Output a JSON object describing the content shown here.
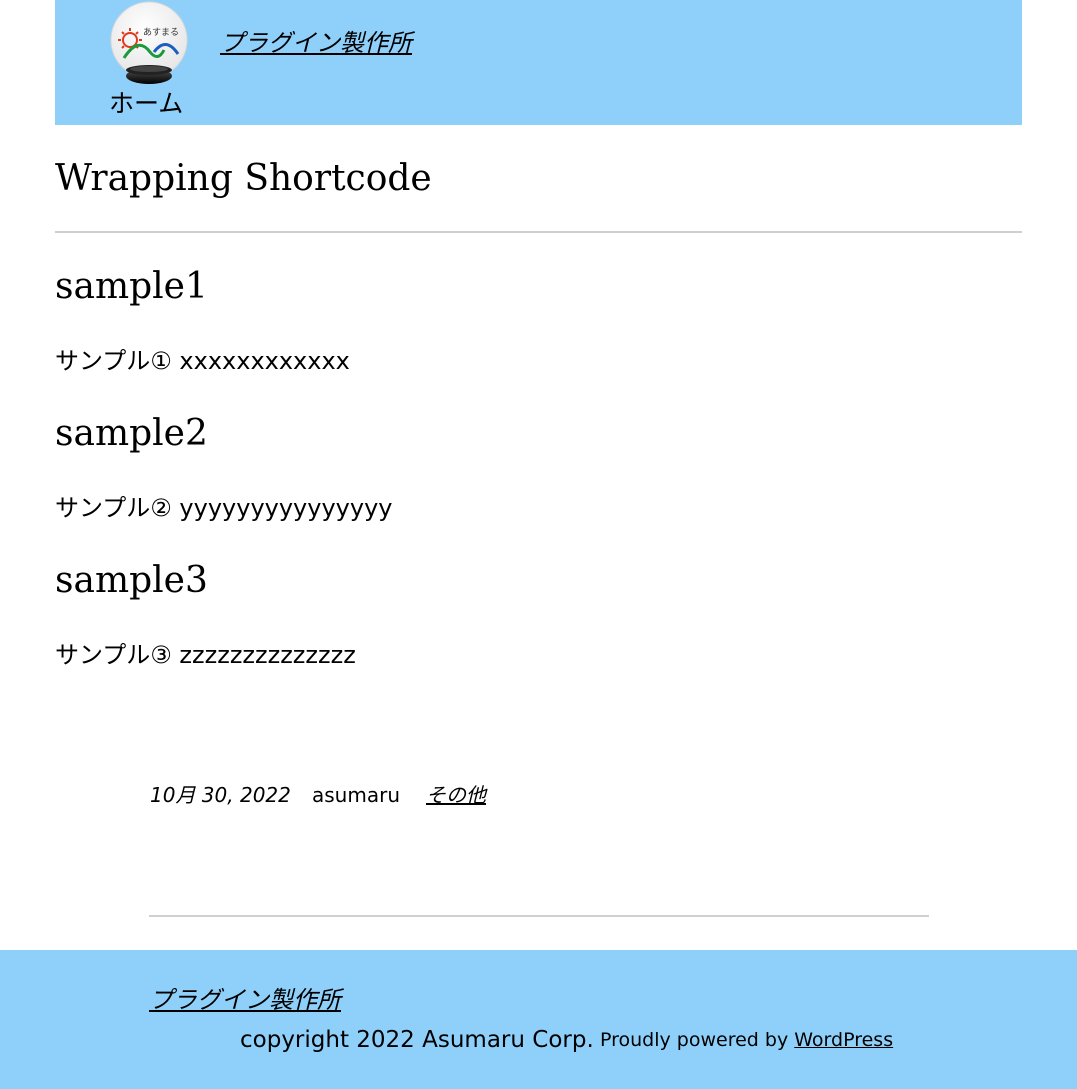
{
  "header": {
    "logo_text": "あすまる",
    "home_label": "ホーム",
    "site_title": "プラグイン製作所"
  },
  "page_title": "Wrapping Shortcode",
  "sections": [
    {
      "heading": "sample1",
      "text": "サンプル① xxxxxxxxxxxx"
    },
    {
      "heading": "sample2",
      "text": "サンプル② yyyyyyyyyyyyyyy"
    },
    {
      "heading": "sample3",
      "text": "サンプル③ zzzzzzzzzzzzzz"
    }
  ],
  "meta": {
    "date": "10月 30, 2022",
    "author": "asumaru",
    "category": "その他"
  },
  "footer": {
    "site_title": "プラグイン製作所",
    "copyright": "copyright 2022 Asumaru Corp.",
    "powered_prefix": "Proudly powered by ",
    "powered_link": "WordPress"
  },
  "colors": {
    "header_bg": "#8fd0fb",
    "footer_bg": "#8fd0fb",
    "divider": "#cfcfcf"
  },
  "icons": {
    "logo": "asumaru-sun-logo-icon"
  }
}
